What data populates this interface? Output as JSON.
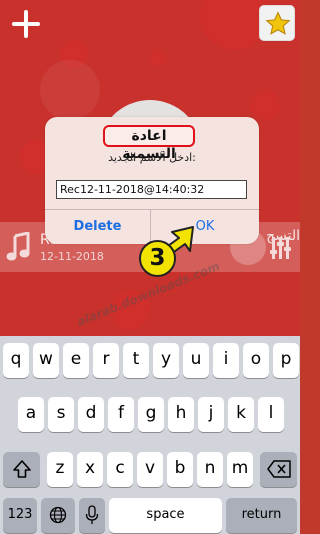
{
  "header": {
    "add_icon": "plus-icon",
    "favorites_icon": "star-icon"
  },
  "side_label": "التسج",
  "recording": {
    "name": "Rec12-11-2018@14:40:32",
    "date": "12-11-2018",
    "music_icon": "music-note-icon",
    "eq_icon": "equalizer-icon"
  },
  "dialog": {
    "title": "اعادة التسمية",
    "message": "ادخل الاسم الجديد:",
    "input_value": "Rec12-11-2018@14:40:32",
    "delete_label": "Delete",
    "ok_label": "OK"
  },
  "annotation": {
    "step_number": "3"
  },
  "watermark": "alarab.downloads.com",
  "keyboard": {
    "row1": [
      "q",
      "w",
      "e",
      "r",
      "t",
      "y",
      "u",
      "i",
      "o",
      "p"
    ],
    "row2": [
      "a",
      "s",
      "d",
      "f",
      "g",
      "h",
      "j",
      "k",
      "l"
    ],
    "row3": [
      "z",
      "x",
      "c",
      "v",
      "b",
      "n",
      "m"
    ],
    "numbers_label": "123",
    "space_label": "space",
    "return_label": "return",
    "shift_icon": "shift-icon",
    "backspace_icon": "backspace-icon",
    "globe_icon": "globe-icon",
    "mic_icon": "microphone-icon"
  },
  "colors": {
    "background": "#c8312c",
    "dialog_bg": "#f5e3e0",
    "button_text": "#1c6ee3",
    "highlight": "#e0101a",
    "badge": "#f2e400"
  }
}
